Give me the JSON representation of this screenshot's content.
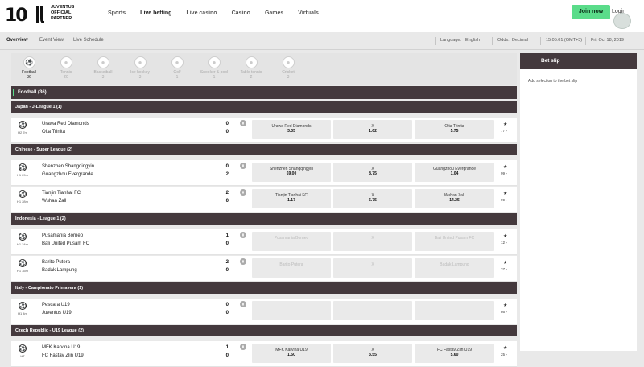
{
  "header": {
    "logo_text": "10",
    "partner_lines": [
      "JUVENTUS",
      "OFFICIAL",
      "PARTNER"
    ],
    "nav": [
      "Sports",
      "Live betting",
      "Live casino",
      "Casino",
      "Games",
      "Virtuals"
    ],
    "active_nav": "Live betting",
    "join_label": "Join now",
    "login_label": "Login"
  },
  "subnav": {
    "tabs": [
      "Overview",
      "Event View",
      "Live Schedule"
    ],
    "language_label": "Language:",
    "language_value": "English",
    "odds_label": "Odds:",
    "odds_value": "Decimal",
    "time": "15:05:01 (GMT+3)",
    "date": "Fri, Oct 18, 2019"
  },
  "sports": [
    {
      "name": "Football",
      "count": "36",
      "icon": "football-icon"
    },
    {
      "name": "Tennis",
      "count": "20",
      "icon": "tennis-icon"
    },
    {
      "name": "Basketball",
      "count": "3",
      "icon": "basketball-icon"
    },
    {
      "name": "Ice hockey",
      "count": "3",
      "icon": "ice-hockey-icon"
    },
    {
      "name": "Golf",
      "count": "1",
      "icon": "golf-icon"
    },
    {
      "name": "Snooker & pool",
      "count": "1",
      "icon": "snooker-icon"
    },
    {
      "name": "Table tennis",
      "count": "2",
      "icon": "table-tennis-icon"
    },
    {
      "name": "Cricket",
      "count": "3",
      "icon": "cricket-icon"
    }
  ],
  "section_title": "Football  (36)",
  "leagues": [
    {
      "name": "Japan - J-League 1  (1)",
      "matches": [
        {
          "time": "H2 7m",
          "home": "Urawa Red Diamonds",
          "away": "Oita Trinita",
          "hs": "0",
          "as": "0",
          "o1n": "Urawa Red Diamonds",
          "o1v": "3.35",
          "oxv": "1.62",
          "o2n": "Oita Trinita",
          "o2v": "5.75",
          "more": "77"
        }
      ]
    },
    {
      "name": "Chinese - Super League  (2)",
      "matches": [
        {
          "time": "H1 29m",
          "home": "Shenzhen Shangqingyin",
          "away": "Guangzhou Evergrande",
          "hs": "0",
          "as": "2",
          "o1n": "Shenzhen Shangqingyin",
          "o1v": "69.00",
          "oxv": "8.75",
          "o2n": "Guangzhou Evergrande",
          "o2v": "1.04",
          "more": "99"
        },
        {
          "time": "H1 28m",
          "home": "Tianjin Tianhai FC",
          "away": "Wuhan Zall",
          "hs": "2",
          "as": "0",
          "o1n": "Tianjin Tianhai FC",
          "o1v": "1.17",
          "oxv": "5.75",
          "o2n": "Wuhan Zall",
          "o2v": "14.25",
          "more": "99"
        }
      ]
    },
    {
      "name": "Indonesia - League 1  (2)",
      "matches": [
        {
          "time": "H1 24m",
          "home": "Pusamania Borneo",
          "away": "Bali United Pusam FC",
          "hs": "1",
          "as": "0",
          "o1n": "Pusamania Borneo",
          "o1v": "",
          "oxv": "",
          "o2n": "Bali United Pusam FC",
          "o2v": "",
          "more": "12",
          "disabled": true
        },
        {
          "time": "H1 35m",
          "home": "Barito Putera",
          "away": "Badak Lampung",
          "hs": "2",
          "as": "0",
          "o1n": "Barito Putera",
          "o1v": "",
          "oxv": "",
          "o2n": "Badak Lampung",
          "o2v": "",
          "more": "37",
          "disabled": true
        }
      ]
    },
    {
      "name": "Italy - Campionato Primavera  (1)",
      "matches": [
        {
          "time": "H1 4m",
          "home": "Pescara U19",
          "away": "Juventus U19",
          "hs": "0",
          "as": "0",
          "o1n": "",
          "o1v": "",
          "oxv": "",
          "o2n": "",
          "o2v": "",
          "more": "86",
          "empty": true
        }
      ]
    },
    {
      "name": "Czech Republic - U19 League  (2)",
      "matches": [
        {
          "time": "HT",
          "home": "MFK Karvina U19",
          "away": "FC Fastav Zlin U19",
          "hs": "1",
          "as": "0",
          "o1n": "MFK Karvina U19",
          "o1v": "1.50",
          "oxv": "3.55",
          "o2n": "FC Fastav Zlin U19",
          "o2v": "5.60",
          "more": "25"
        }
      ]
    }
  ],
  "odds_x_label": "X",
  "betslip": {
    "title": "Bet slip",
    "message": "Add selection to the bet slip"
  }
}
